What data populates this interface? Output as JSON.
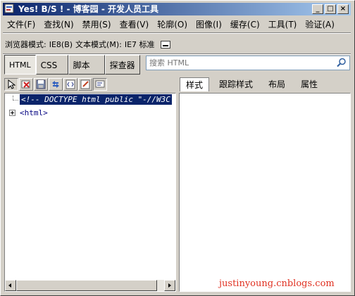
{
  "window": {
    "title": "Yes! B/S ! - 博客园 - 开发人员工具",
    "buttons": {
      "minimize": "_",
      "maximize": "□",
      "close": "×"
    }
  },
  "menu": [
    "文件(F)",
    "查找(N)",
    "禁用(S)",
    "查看(V)",
    "轮廓(O)",
    "图像(I)",
    "缓存(C)",
    "工具(T)",
    "验证(A)"
  ],
  "modebar": {
    "browser_mode_label": "浏览器模式:",
    "browser_mode_value": "IE8(B)",
    "doc_mode_label": "文本模式(M):",
    "doc_mode_value": "IE7 标准"
  },
  "tabs": [
    "HTML",
    "CSS",
    "脚本",
    "探查器"
  ],
  "search": {
    "placeholder": "搜索 HTML"
  },
  "right_tabs": [
    "样式",
    "跟踪样式",
    "布局",
    "属性"
  ],
  "tree": {
    "doctype": "<!-- DOCTYPE html public \"-//W3C",
    "html_node": "<html>"
  },
  "watermark": "justinyoung.cnblogs.com"
}
